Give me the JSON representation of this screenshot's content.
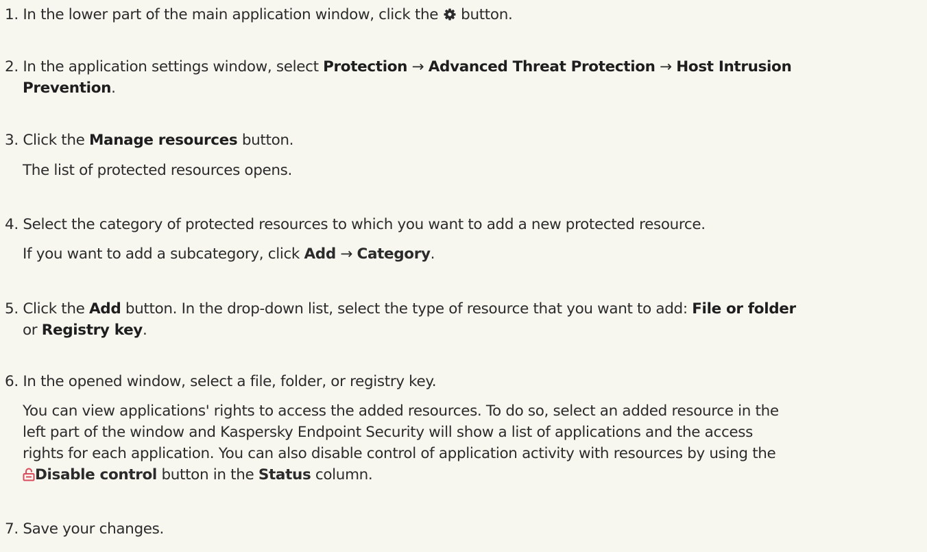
{
  "steps": [
    {
      "number": "1.",
      "pre": "In the lower part of the main application window, click the",
      "icon": "gear-icon",
      "post": "button."
    },
    {
      "number": "2.",
      "pre": "In the application settings window, select",
      "b1": "Protection",
      "arrow1": "→",
      "b2": "Advanced Threat Protection",
      "arrow2": "→",
      "b3": "Host Intrusion",
      "b3_cont": "Prevention",
      "end": "."
    },
    {
      "number": "3.",
      "pre": "Click the",
      "b1": "Manage resources",
      "post": "button.",
      "sub": "The list of protected resources opens."
    },
    {
      "number": "4.",
      "text": "Select the category of protected resources to which you want to add a new protected resource.",
      "sub_pre": "If you want to add a subcategory, click",
      "sub_b1": "Add",
      "sub_arrow": "→",
      "sub_b2": "Category",
      "sub_end": "."
    },
    {
      "number": "5.",
      "pre": "Click the",
      "b1": "Add",
      "mid": "button. In the drop-down list, select the type of resource that you want to add:",
      "b2": "File or folder",
      "cont_pre": "or",
      "b3": "Registry key",
      "end": "."
    },
    {
      "number": "6.",
      "text": "In the opened window, select a file, folder, or registry key.",
      "sub_line1": "You can view applications' rights to access the added resources. To do so, select an added resource in the",
      "sub_line2": "left part of the window and Kaspersky Endpoint Security will show a list of applications and the access",
      "sub_line3": "rights for each application. You can also disable control of application activity with resources by using the",
      "sub_icon": "unlock-icon",
      "sub_b1": "Disable control",
      "sub_mid": "button in the",
      "sub_b2": "Status",
      "sub_end": "column."
    },
    {
      "number": "7.",
      "text": "Save your changes."
    }
  ],
  "colors": {
    "background": "#f7f7f0",
    "text": "#2b2b2b",
    "unlock_icon": "#d94a5a"
  }
}
